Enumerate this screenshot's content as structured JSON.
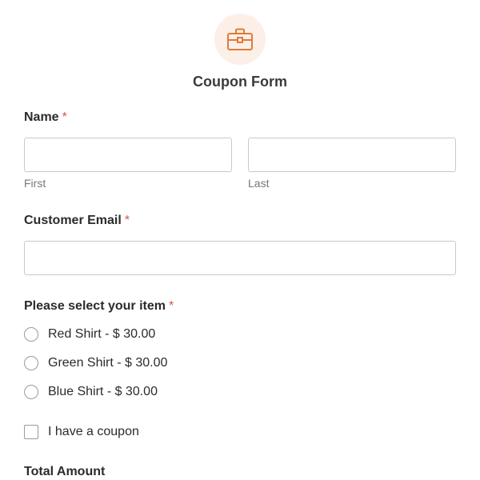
{
  "header": {
    "icon": "briefcase-icon",
    "title": "Coupon Form",
    "accent_color": "#e07b39",
    "icon_bg_color": "#fcefe8"
  },
  "name_field": {
    "label": "Name",
    "required_mark": "*",
    "first": {
      "value": "",
      "sublabel": "First"
    },
    "last": {
      "value": "",
      "sublabel": "Last"
    }
  },
  "email_field": {
    "label": "Customer Email",
    "required_mark": "*",
    "value": ""
  },
  "item_field": {
    "label": "Please select your item",
    "required_mark": "*",
    "options": [
      {
        "label": "Red Shirt - $ 30.00",
        "selected": false
      },
      {
        "label": "Green Shirt - $ 30.00",
        "selected": false
      },
      {
        "label": "Blue Shirt - $ 30.00",
        "selected": false
      }
    ]
  },
  "coupon_checkbox": {
    "label": "I have a coupon",
    "checked": false
  },
  "total_amount": {
    "label": "Total Amount"
  },
  "colors": {
    "required": "#d9534f",
    "border": "#c9c9c9",
    "sublabel": "#777777"
  }
}
